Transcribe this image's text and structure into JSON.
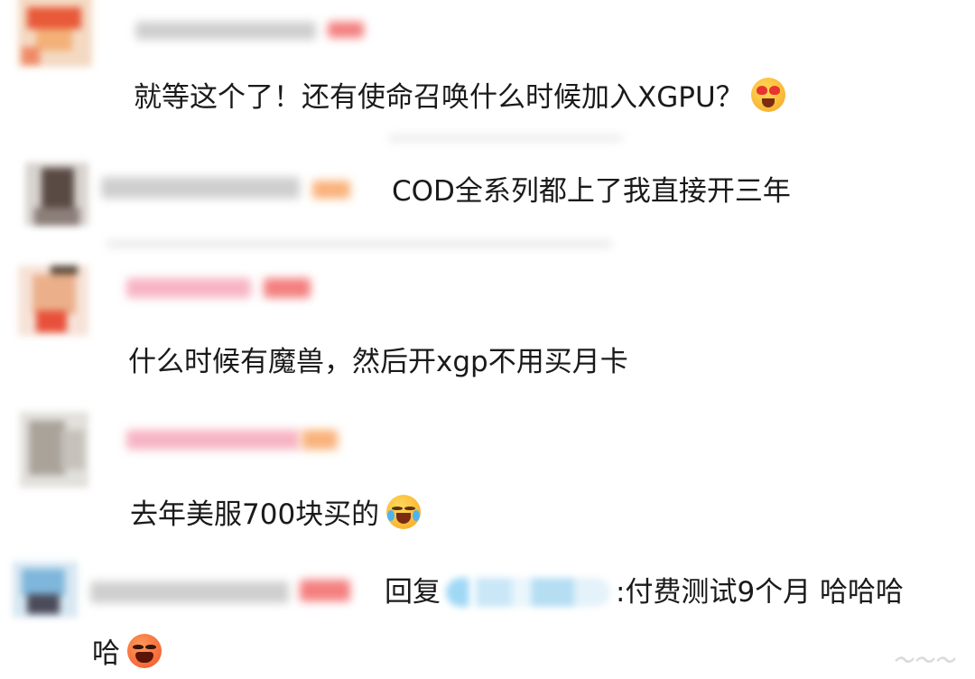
{
  "comments": [
    {
      "text": "就等这个了！还有使命召唤什么时候加入XGPU？",
      "emoji": "heart-eyes-emoji"
    },
    {
      "text": "COD全系列都上了我直接开三年"
    },
    {
      "text": "什么时候有魔兽，然后开xgp不用买月卡"
    },
    {
      "text": "去年美服700块买的",
      "emoji": "laughing-crying-emoji"
    },
    {
      "reply_prefix": "回复",
      "text": ":付费测试9个月 哈哈哈",
      "text_line2": "哈",
      "emoji": "laughing-emoji"
    }
  ],
  "colors": {
    "text": "#1a1a1a",
    "username_blur": "#cfcfcf",
    "pink_blur": "#f7b4c4",
    "badge_red": "#f47f7f",
    "badge_orange": "#f9b27a",
    "mention_blue": "#9fd8f5"
  }
}
